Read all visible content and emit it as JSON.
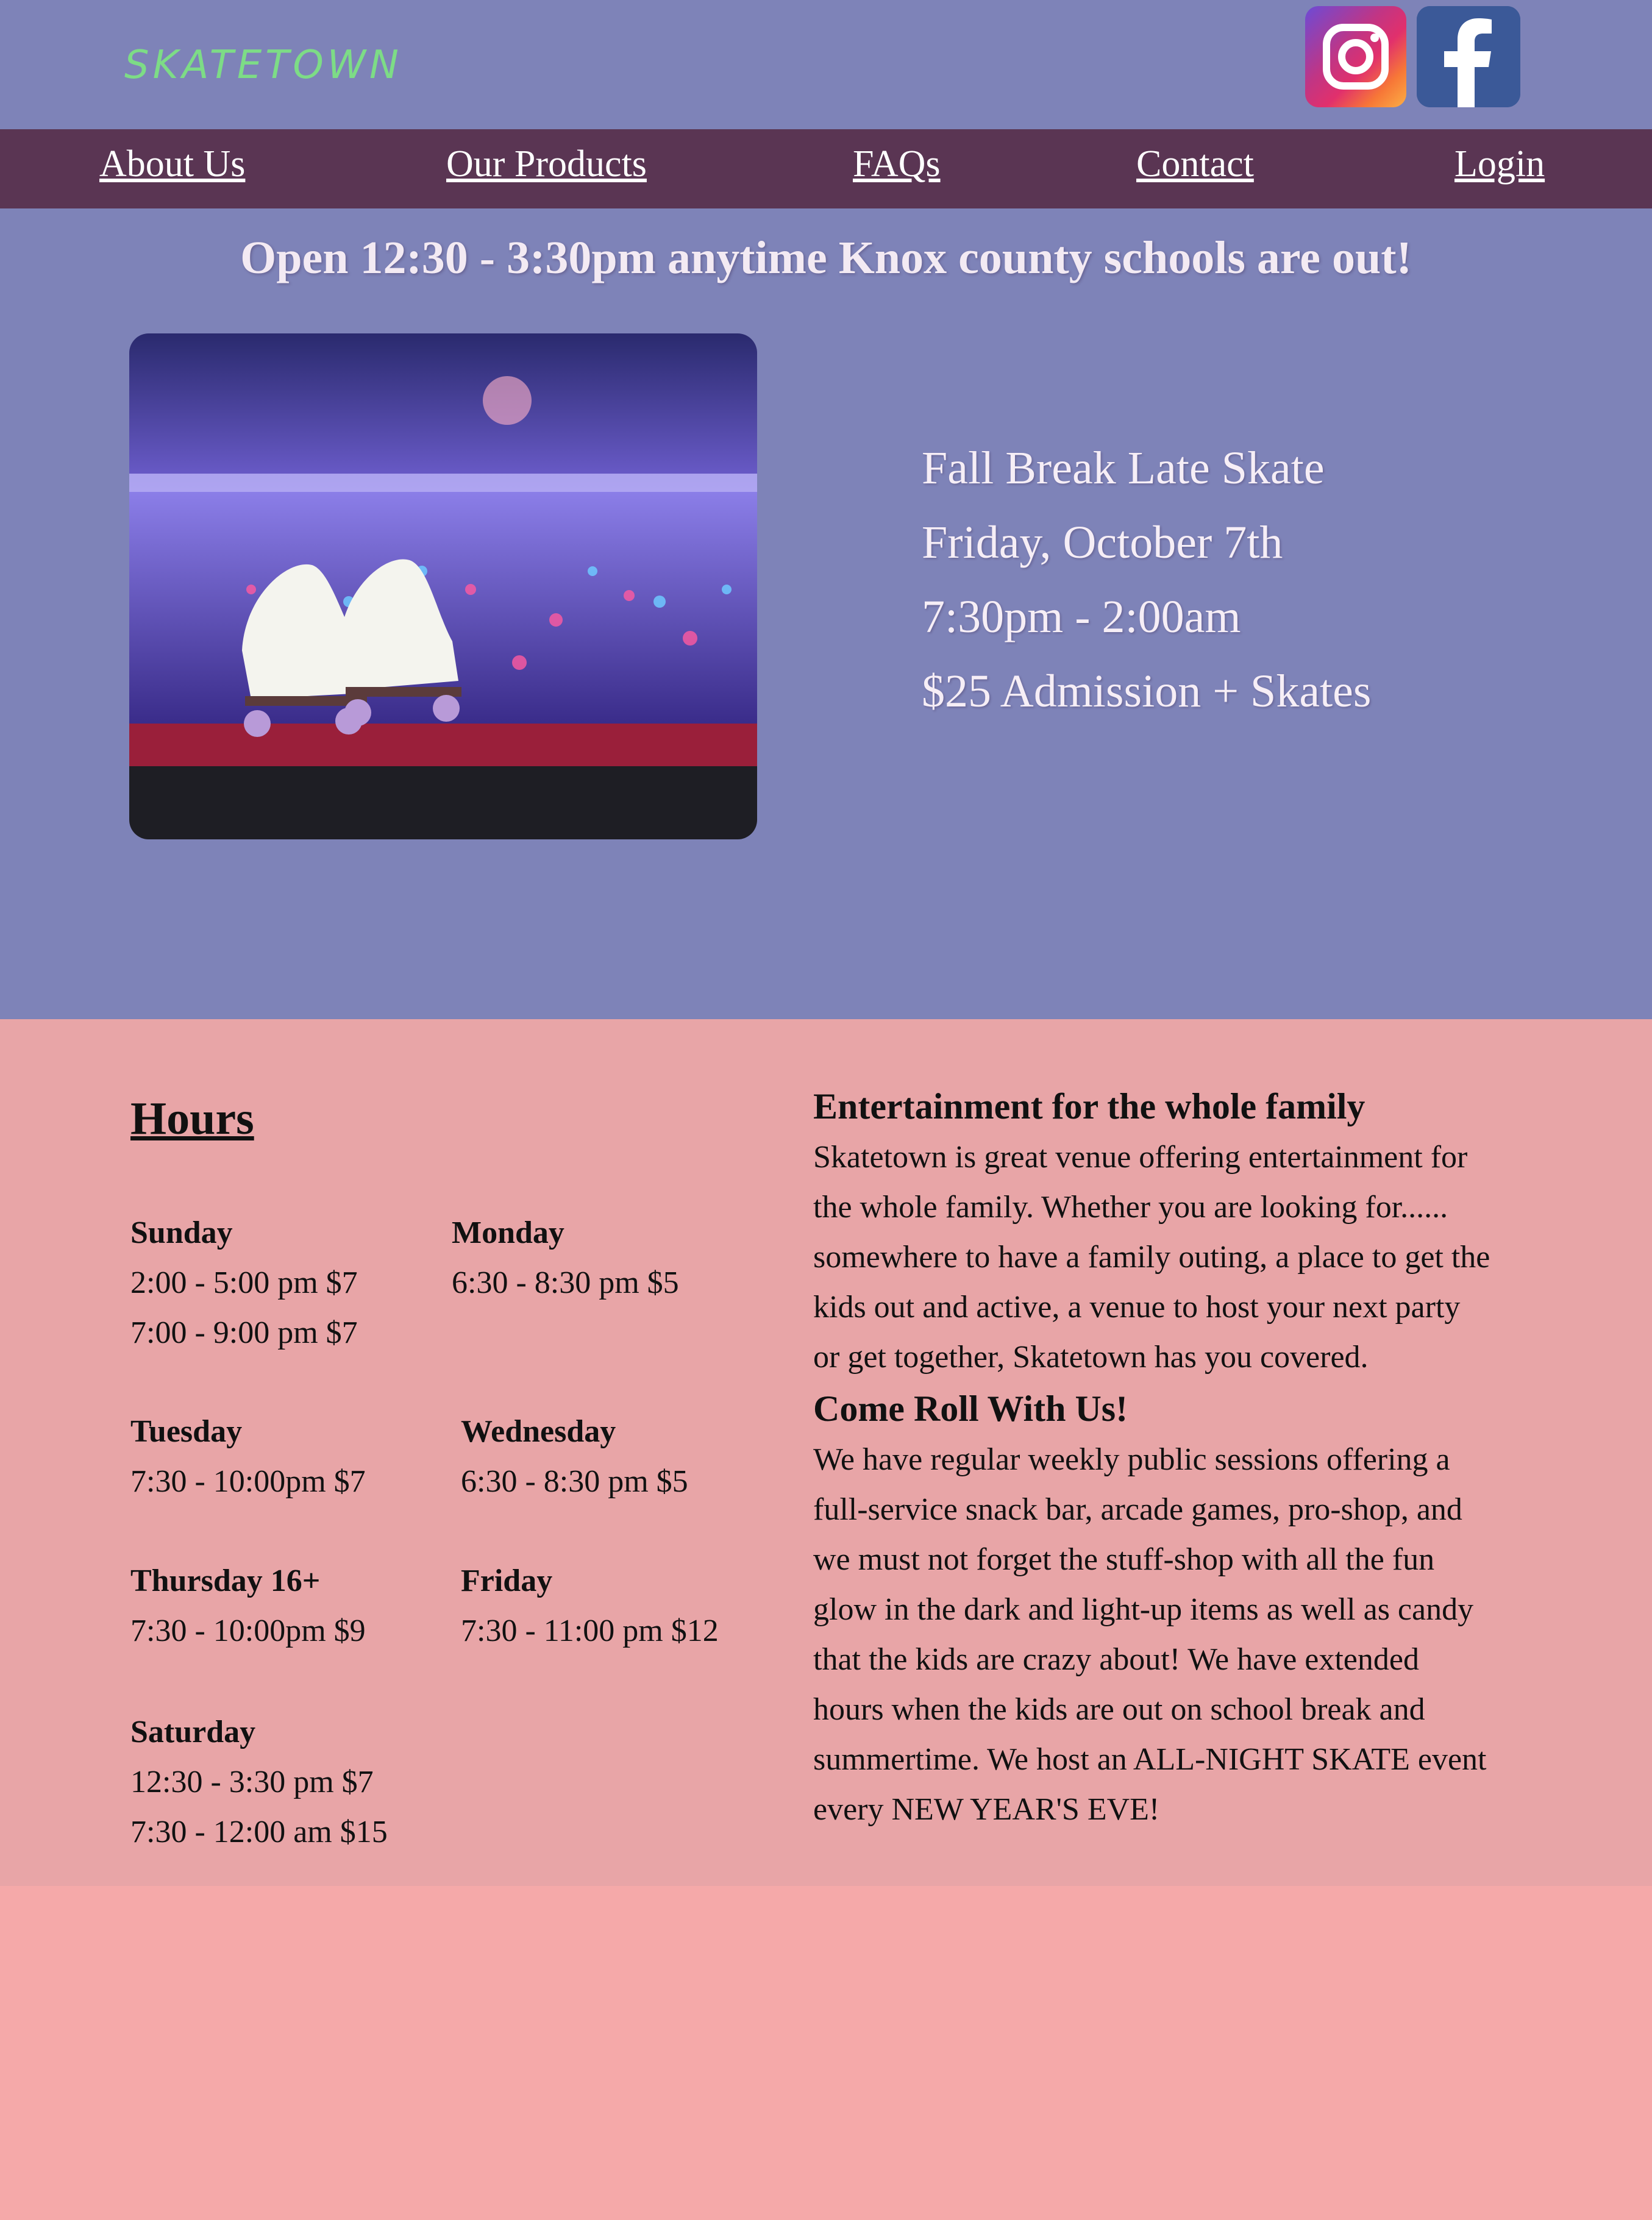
{
  "header": {
    "logo": "SKATETOWN",
    "social": [
      {
        "name": "instagram-icon"
      },
      {
        "name": "facebook-icon"
      }
    ]
  },
  "nav": {
    "items": [
      "About Us",
      "Our Products",
      "FAQs",
      "Contact",
      "Login"
    ]
  },
  "hero": {
    "banner": "Open 12:30 - 3:30pm anytime Knox county schools are out!",
    "event": {
      "title": "Fall Break Late Skate",
      "date": "Friday, October 7th",
      "time": "7:30pm - 2:00am",
      "price": "$25 Admission + Skates"
    }
  },
  "hours": {
    "title": "Hours",
    "days": [
      {
        "name": "Sunday",
        "lines": [
          "2:00 - 5:00 pm $7",
          "7:00 - 9:00 pm $7"
        ]
      },
      {
        "name": "Monday",
        "lines": [
          "6:30 - 8:30 pm $5"
        ]
      },
      {
        "name": "Tuesday",
        "lines": [
          "7:30 - 10:00pm $7"
        ]
      },
      {
        "name": "Wednesday",
        "lines": [
          "6:30 - 8:30 pm $5"
        ]
      },
      {
        "name": "Thursday 16+",
        "lines": [
          "7:30 - 10:00pm $9"
        ]
      },
      {
        "name": "Friday",
        "lines": [
          "7:30 - 11:00 pm $12"
        ]
      },
      {
        "name": "Saturday",
        "lines": [
          "12:30 - 3:30 pm $7",
          "7:30 - 12:00 am $15"
        ]
      }
    ]
  },
  "about": {
    "heading1": "Entertainment for the whole family",
    "para1": [
      "Skatetown is great venue offering entertainment for",
      "the whole family. Whether you are looking for......",
      "somewhere to have a family outing, a place to get the",
      "kids out and active, a venue to host your next party",
      "or get together, Skatetown has you covered."
    ],
    "heading2": "Come Roll With Us!",
    "para2": [
      "We have regular weekly public sessions offering a",
      "full-service snack bar, arcade games, pro-shop, and",
      "we must not forget the stuff-shop with all the fun",
      "glow in the dark and light-up items as well as candy",
      "that the kids are crazy about! We have extended",
      "hours when the kids are out on school break and",
      "summertime. We host an ALL-NIGHT SKATE event",
      "every NEW YEAR'S EVE!"
    ]
  },
  "colors": {
    "header_bg": "#7e83b8",
    "nav_bg": "#5a3553",
    "logo": "#7ddc86",
    "info_bg": "#e8a5a7",
    "page_bg": "#f5a9a9"
  }
}
